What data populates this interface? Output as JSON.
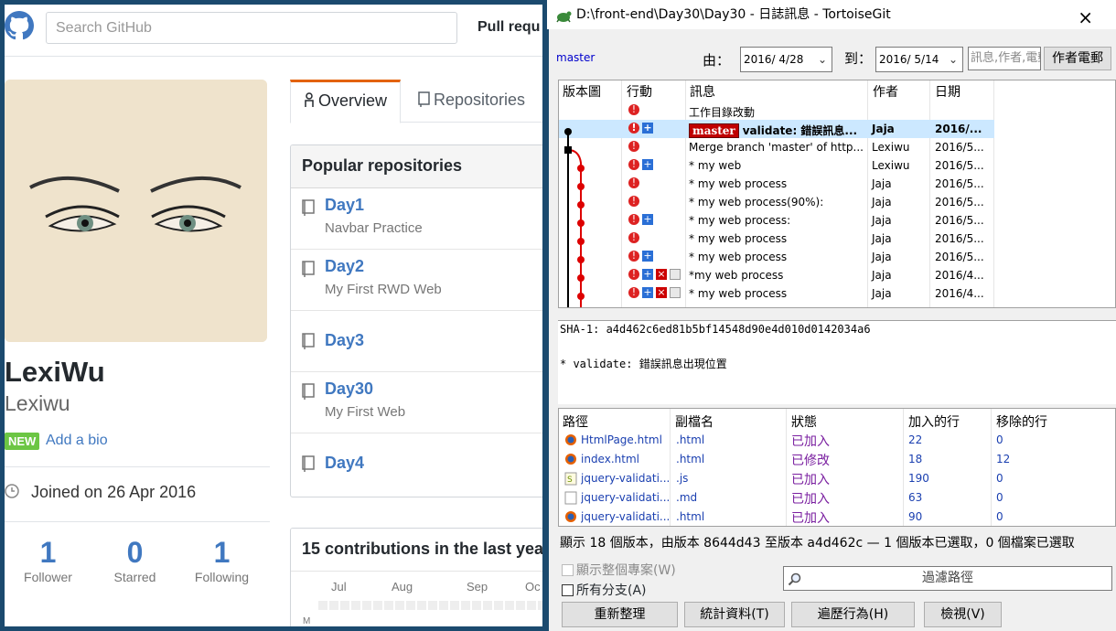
{
  "github": {
    "search_placeholder": "Search GitHub",
    "nav_partial": "Pull requ",
    "profile": {
      "name": "LexiWu",
      "login": "Lexiwu",
      "new_badge": "NEW",
      "add_bio": "Add a bio",
      "joined": "Joined on 26 Apr 2016",
      "stats": [
        {
          "num": "1",
          "label": "Follower"
        },
        {
          "num": "0",
          "label": "Starred"
        },
        {
          "num": "1",
          "label": "Following"
        }
      ]
    },
    "tabs": [
      {
        "label": "Overview",
        "selected": true
      },
      {
        "label": "Repositories",
        "selected": false
      }
    ],
    "popular": {
      "heading": "Popular repositories",
      "repos": [
        {
          "name": "Day1",
          "desc": "Navbar Practice"
        },
        {
          "name": "Day2",
          "desc": "My First RWD Web"
        },
        {
          "name": "Day3",
          "desc": ""
        },
        {
          "name": "Day30",
          "desc": "My First Web"
        },
        {
          "name": "Day4",
          "desc": ""
        }
      ]
    },
    "contributions": {
      "heading": "15 contributions in the last year",
      "months": [
        "Jul",
        "Aug",
        "Sep",
        "Oc"
      ],
      "day_label": "M"
    },
    "colors": {
      "link": "#4078c0",
      "new_badge": "#6cc644",
      "accent_tab": "#e36209"
    }
  },
  "tortoise": {
    "title": "D:\\front-end\\Day30\\Day30 - 日誌訊息 - TortoiseGit",
    "close": "×",
    "branch": "master",
    "from_label": "由：",
    "from_date": "2016/ 4/28",
    "to_label": "到：",
    "to_date": "2016/ 5/14",
    "filter_placeholder": "訊息,作者,電郵",
    "filter_button": "作者電郵",
    "columns": {
      "graph": "版本圖",
      "actions": "行動",
      "message": "訊息",
      "author": "作者",
      "date": "日期"
    },
    "commits": [
      {
        "message": "工作目錄改動",
        "author": "",
        "date": "",
        "actions": [
          "mod"
        ]
      },
      {
        "message": "validate: 錯誤訊息...",
        "author": "Jaja",
        "date": "2016/...",
        "actions": [
          "mod",
          "add"
        ],
        "tag": "master",
        "selected": true
      },
      {
        "message": "Merge branch 'master' of http...",
        "author": "Lexiwu",
        "date": "2016/5...",
        "actions": [
          "mod"
        ]
      },
      {
        "message": "* my web",
        "author": "Lexiwu",
        "date": "2016/5...",
        "actions": [
          "mod",
          "add"
        ]
      },
      {
        "message": "* my web process",
        "author": "Jaja",
        "date": "2016/5...",
        "actions": [
          "mod"
        ]
      },
      {
        "message": "* my web process(90%):",
        "author": "Jaja",
        "date": "2016/5...",
        "actions": [
          "mod"
        ]
      },
      {
        "message": "* my web process:",
        "author": "Jaja",
        "date": "2016/5...",
        "actions": [
          "mod",
          "add"
        ]
      },
      {
        "message": "* my web process",
        "author": "Jaja",
        "date": "2016/5...",
        "actions": [
          "mod"
        ]
      },
      {
        "message": "* my web process",
        "author": "Jaja",
        "date": "2016/5...",
        "actions": [
          "mod",
          "add"
        ]
      },
      {
        "message": "*my web process",
        "author": "Jaja",
        "date": "2016/4...",
        "actions": [
          "mod",
          "add",
          "del",
          "pg"
        ]
      },
      {
        "message": "* my web process",
        "author": "Jaja",
        "date": "2016/4...",
        "actions": [
          "mod",
          "add",
          "del",
          "pg"
        ]
      }
    ],
    "sha_line": "SHA-1: a4d462c6ed81b5bf14548d90e4d010d0142034a6",
    "commit_message": "* validate: 錯誤訊息出現位置",
    "file_columns": {
      "path": "路徑",
      "ext": "副檔名",
      "status": "狀態",
      "added": "加入的行",
      "removed": "移除的行"
    },
    "files": [
      {
        "name": "HtmlPage.html",
        "ext": ".html",
        "status": "已加入",
        "added": "22",
        "removed": "0",
        "icon": "html"
      },
      {
        "name": "index.html",
        "ext": ".html",
        "status": "已修改",
        "added": "18",
        "removed": "12",
        "icon": "html"
      },
      {
        "name": "jquery-validati...",
        "ext": ".js",
        "status": "已加入",
        "added": "190",
        "removed": "0",
        "icon": "js"
      },
      {
        "name": "jquery-validati...",
        "ext": ".md",
        "status": "已加入",
        "added": "63",
        "removed": "0",
        "icon": "md"
      },
      {
        "name": "jquery-validati...",
        "ext": ".html",
        "status": "已加入",
        "added": "90",
        "removed": "0",
        "icon": "html"
      }
    ],
    "status_line": "顯示 18 個版本，由版本 8644d43 至版本 a4d462c — 1 個版本已選取，0 個檔案已選取",
    "check_whole_project": "顯示整個專案(W)",
    "check_all_branches": "所有分支(A)",
    "path_filter": "過濾路徑",
    "buttons": [
      "重新整理",
      "統計資料(T)",
      "遍歷行為(H)",
      "檢視(V)"
    ]
  }
}
